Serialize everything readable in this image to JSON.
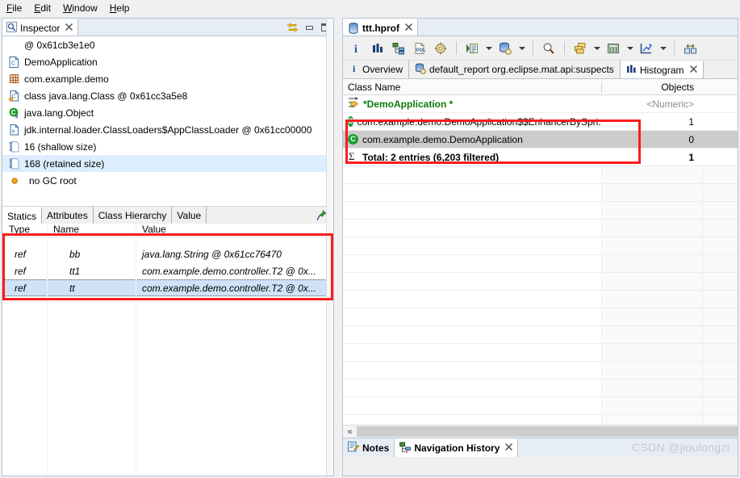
{
  "menubar": {
    "items": [
      {
        "label": "File",
        "mnemonic": "F"
      },
      {
        "label": "Edit",
        "mnemonic": "E"
      },
      {
        "label": "Window",
        "mnemonic": "W"
      },
      {
        "label": "Help",
        "mnemonic": "H"
      }
    ]
  },
  "colors": {
    "annotation": "#fc1c1c",
    "filter_green": "#0b7a0b",
    "class_icon_green": "#1d9d2e",
    "selection_blue": "#ddeeff",
    "selection_gray": "#cccccc",
    "watermark": "#c8c8c8"
  },
  "inspector": {
    "tab_label": "Inspector",
    "tab_close": "✕",
    "controls": [
      {
        "name": "link-with-editor-icon",
        "label": ""
      },
      {
        "name": "minimize-icon",
        "label": ""
      },
      {
        "name": "maximize-icon",
        "label": ""
      }
    ],
    "rows": [
      {
        "icon": "at-icon",
        "label": "@ 0x61cb3e1e0",
        "selected": false
      },
      {
        "icon": "class-file-icon",
        "label": "DemoApplication",
        "selected": false
      },
      {
        "icon": "package-icon",
        "label": "com.example.demo",
        "selected": false
      },
      {
        "icon": "class-obj-icon",
        "label": "class java.lang.Class @ 0x61cc3a5e8",
        "selected": false
      },
      {
        "icon": "superclass-icon",
        "label": "java.lang.Object",
        "selected": false
      },
      {
        "icon": "classloader-icon",
        "label": "jdk.internal.loader.ClassLoaders$AppClassLoader @ 0x61cc00000",
        "selected": false
      },
      {
        "icon": "shallow-size-icon",
        "label": "16 (shallow size)",
        "selected": false
      },
      {
        "icon": "retained-size-icon",
        "label": "168 (retained size)",
        "selected": true
      },
      {
        "icon": "gc-root-icon",
        "label": "no GC root",
        "selected": false
      }
    ],
    "detail_tabs": [
      {
        "label": "Statics",
        "active": true
      },
      {
        "label": "Attributes",
        "active": false
      },
      {
        "label": "Class Hierarchy",
        "active": false
      },
      {
        "label": "Value",
        "active": false
      }
    ],
    "pin_icon": "pin-icon",
    "statics_table": {
      "columns": [
        "Type",
        "Name",
        "Value"
      ],
      "rows": [
        {
          "type": "ref",
          "name": "bb",
          "value": "java.lang.String @ 0x61cc76470",
          "selected": false
        },
        {
          "type": "ref",
          "name": "tt1",
          "value": "com.example.demo.controller.T2 @ 0x...",
          "selected": false
        },
        {
          "type": "ref",
          "name": "tt",
          "value": "com.example.demo.controller.T2 @ 0x...",
          "selected": true
        }
      ]
    }
  },
  "editor": {
    "tab_label": "ttt.hprof",
    "tab_close": "✕",
    "tab_icon": "heap-dump-icon",
    "toolbar": [
      {
        "name": "overview-info-icon",
        "glyph": "i",
        "dropdown": false
      },
      {
        "name": "histogram-icon",
        "glyph": "",
        "dropdown": false
      },
      {
        "name": "dominator-tree-icon",
        "glyph": "",
        "dropdown": false
      },
      {
        "name": "oql-icon",
        "glyph": "OQL",
        "dropdown": false
      },
      {
        "name": "settings-gear-icon",
        "glyph": "",
        "dropdown": false
      },
      {
        "name": "separator-1",
        "glyph": "|",
        "dropdown": false
      },
      {
        "name": "run-report-icon",
        "glyph": "",
        "dropdown": true
      },
      {
        "name": "query-browser-icon",
        "glyph": "",
        "dropdown": true
      },
      {
        "name": "separator-2",
        "glyph": "|",
        "dropdown": false
      },
      {
        "name": "search-icon",
        "glyph": "",
        "dropdown": false
      },
      {
        "name": "separator-3",
        "glyph": "|",
        "dropdown": false
      },
      {
        "name": "group-by-icon",
        "glyph": "",
        "dropdown": true
      },
      {
        "name": "calculate-retained-size-icon",
        "glyph": "",
        "dropdown": true
      },
      {
        "name": "export-chart-icon",
        "glyph": "",
        "dropdown": true
      },
      {
        "name": "separator-4",
        "glyph": "|",
        "dropdown": false
      },
      {
        "name": "compare-icon",
        "glyph": "",
        "dropdown": false
      }
    ],
    "inner_tabs": [
      {
        "label": "Overview",
        "icon": "info-icon",
        "active": false,
        "closable": false
      },
      {
        "label": "default_report org.eclipse.mat.api:suspects",
        "icon": "report-icon",
        "active": false,
        "closable": false
      },
      {
        "label": "Histogram",
        "icon": "histogram-bars-icon",
        "active": true,
        "closable": true
      }
    ],
    "histogram": {
      "columns": [
        {
          "label": "Class Name",
          "align": "left"
        },
        {
          "label": "Objects",
          "align": "right"
        }
      ],
      "filter_row": {
        "class_name": "*DemoApplication *",
        "objects": "<Numeric>",
        "icon": "filter-icon"
      },
      "rows": [
        {
          "icon": "class-icon",
          "class_name": "com.example.demo.DemoApplication$$EnhancerBySpri...",
          "objects": "1",
          "selected": false
        },
        {
          "icon": "class-icon",
          "class_name": "com.example.demo.DemoApplication",
          "objects": "0",
          "selected": true
        }
      ],
      "total_row": {
        "icon": "sigma-icon",
        "label": "Total: 2 entries (6,203 filtered)",
        "objects": "1"
      },
      "empty_row_count": 16,
      "hscroll_left_glyph": "«"
    },
    "bottom_tabs": [
      {
        "label": "Notes",
        "icon": "notes-icon",
        "active": false,
        "closable": false
      },
      {
        "label": "Navigation History",
        "icon": "nav-history-icon",
        "active": true,
        "closable": true
      }
    ],
    "watermark": "CSDN @jioulongzi"
  },
  "annotations": [
    {
      "name": "histogram-rows-highlight"
    },
    {
      "name": "statics-table-highlight"
    }
  ]
}
